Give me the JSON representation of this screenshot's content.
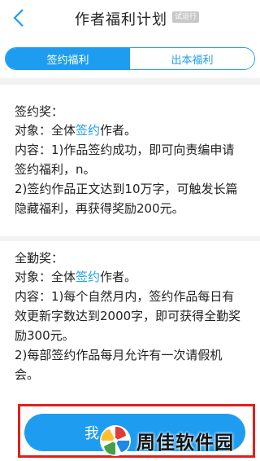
{
  "header": {
    "title": "作者福利计划",
    "badge": "试运行",
    "back_icon": "chevron-left-icon"
  },
  "tabs": [
    {
      "label": "签约福利",
      "active": true
    },
    {
      "label": "出本福利",
      "active": false
    }
  ],
  "colors": {
    "accent": "#1e9df0",
    "highlight_frame": "#e0201c"
  },
  "sections": [
    {
      "title": "签约奖：",
      "target_prefix": "对象：全体",
      "target_link": "签约",
      "target_suffix": "作者。",
      "content_1": "内容：1)作品签约成功，即可向责编申请签约福利，n。",
      "content_2": "2)签约作品正文达到10万字，可触发长篇隐藏福利，再获得奖励200元。"
    },
    {
      "title": "全勤奖：",
      "target_prefix": "对象：全体",
      "target_link": "签约",
      "target_suffix": "作者。",
      "content_1": "内容：1)每个自然月内，签约作品每日有效更新字数达到2000字，即可获得全勤奖励300元。",
      "content_2": "2)每部签约作品每月允许有一次请假机会。"
    }
  ],
  "bottom": {
    "button_label": "我"
  },
  "watermark": {
    "text": "周佳软件园"
  }
}
